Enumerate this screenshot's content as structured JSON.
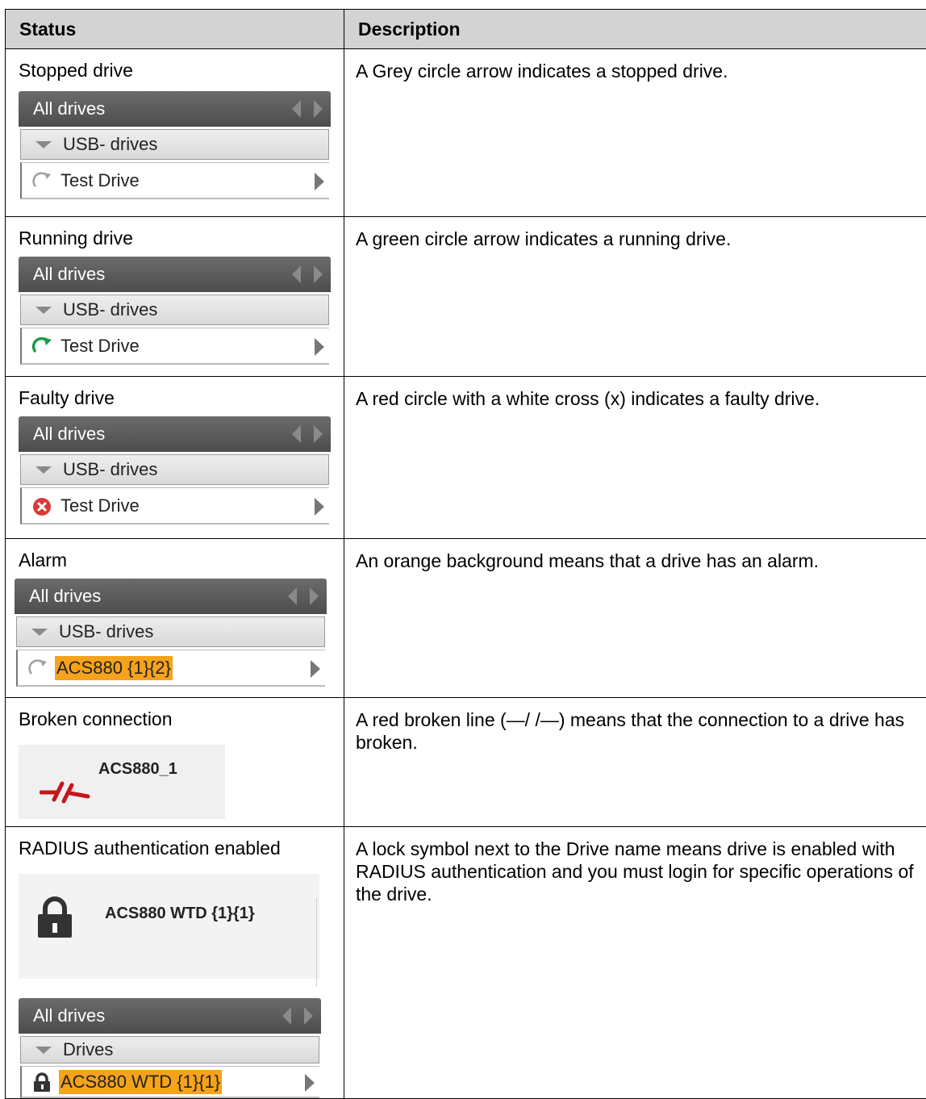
{
  "table": {
    "headers": {
      "status": "Status",
      "description": "Description"
    },
    "rows": [
      {
        "status": "Stopped drive",
        "description": "A Grey circle arrow indicates a stopped drive.",
        "panel": {
          "header": "All drives",
          "group": "USB- drives",
          "drive": "Test Drive",
          "icon": "grey-circle-arrow-icon"
        }
      },
      {
        "status": "Running drive",
        "description": "A green circle arrow indicates a running drive.",
        "panel": {
          "header": "All drives",
          "group": "USB- drives",
          "drive": "Test Drive",
          "icon": "green-circle-arrow-icon"
        }
      },
      {
        "status": "Faulty drive",
        "description": "A red circle with a white cross (x) indicates a faulty drive.",
        "panel": {
          "header": "All drives",
          "group": "USB- drives",
          "drive": "Test Drive",
          "icon": "red-cross-circle-icon"
        }
      },
      {
        "status": "Alarm",
        "description": "An orange background means that a drive has an alarm.",
        "panel": {
          "header": "All drives",
          "group": "USB- drives",
          "drive": "ACS880 {1}{2}",
          "icon": "grey-circle-arrow-icon"
        }
      },
      {
        "status": "Broken connection",
        "description": "A red broken line (—/ /—) means that the connection to a drive has broken.",
        "drive_name": "ACS880_1",
        "icon": "broken-connection-icon"
      },
      {
        "status": "RADIUS authentication enabled",
        "description": "A lock symbol next to the Drive name means drive is enabled with RADIUS authentication and you must login for specific operations of the drive.",
        "drive_name": "ACS880 WTD {1}{1}",
        "icon": "lock-icon",
        "panel": {
          "header": "All drives",
          "group": "Drives",
          "drive": "ACS880 WTD {1}{1}",
          "icon": "lock-icon"
        }
      }
    ]
  },
  "colors": {
    "header_bg": "#d3d3d3",
    "alarm": "#f5a21c",
    "running": "#1e9a4c",
    "faulty": "#d93a3a",
    "broken": "#c4161c"
  }
}
